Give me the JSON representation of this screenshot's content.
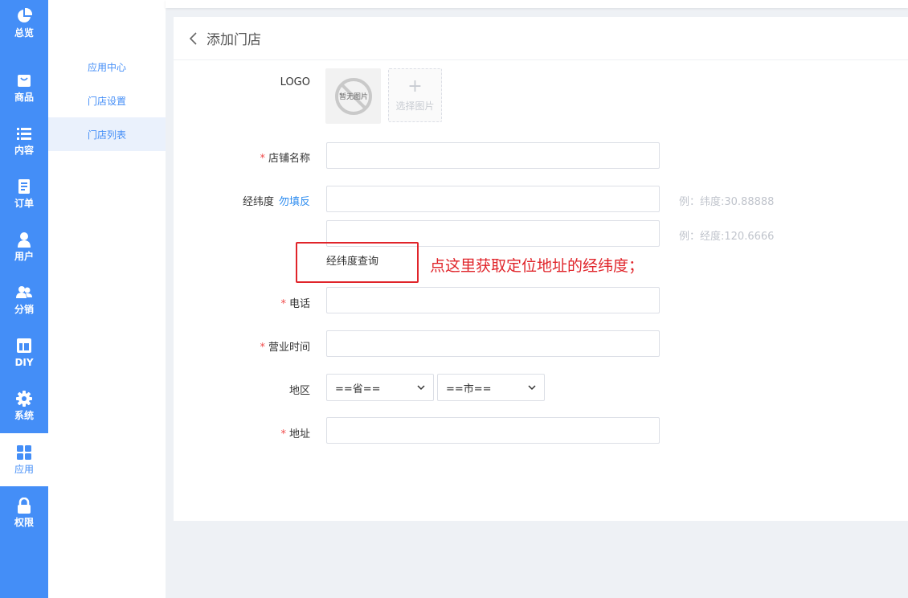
{
  "rail": {
    "items": [
      {
        "label": "总览",
        "icon": "pie-chart-icon"
      },
      {
        "label": "商品",
        "icon": "shopping-bag-icon"
      },
      {
        "label": "内容",
        "icon": "list-icon"
      },
      {
        "label": "订单",
        "icon": "document-icon"
      },
      {
        "label": "用户",
        "icon": "user-icon"
      },
      {
        "label": "分销",
        "icon": "users-icon"
      },
      {
        "label": "DIY",
        "icon": "layout-icon"
      },
      {
        "label": "系统",
        "icon": "gear-icon"
      },
      {
        "label": "应用",
        "icon": "grid-icon"
      },
      {
        "label": "权限",
        "icon": "lock-icon"
      }
    ],
    "active": "应用",
    "accent": "#448ef7"
  },
  "submenu": {
    "items": [
      {
        "label": "应用中心"
      },
      {
        "label": "门店设置"
      },
      {
        "label": "门店列表"
      }
    ],
    "active": "门店列表"
  },
  "page": {
    "title": "添加门店",
    "back_icon": "chevron-left-icon"
  },
  "form": {
    "logo": {
      "label": "LOGO",
      "no_image_text": "暂无图片",
      "pick_label": "选择图片",
      "pick_icon": "plus-icon"
    },
    "store_name": {
      "label": "店铺名称",
      "required": true,
      "value": ""
    },
    "coords": {
      "label": "经纬度",
      "link": "勿填反",
      "lat_hint": "例：纬度:30.88888",
      "lng_hint": "例：经度:120.6666",
      "lat_value": "",
      "lng_value": ""
    },
    "geo_query": {
      "label": "经纬度查询"
    },
    "annotation": "点这里获取定位地址的经纬度；",
    "phone": {
      "label": "电话",
      "required": true,
      "value": ""
    },
    "hours": {
      "label": "营业时间",
      "required": true,
      "value": ""
    },
    "region": {
      "label": "地区",
      "province": "==省==",
      "city": "==市=="
    },
    "address": {
      "label": "地址",
      "required": true,
      "value": ""
    }
  },
  "colors": {
    "required": "#f04a4a",
    "annotation": "#e0242a",
    "link": "#2d8cf0"
  }
}
